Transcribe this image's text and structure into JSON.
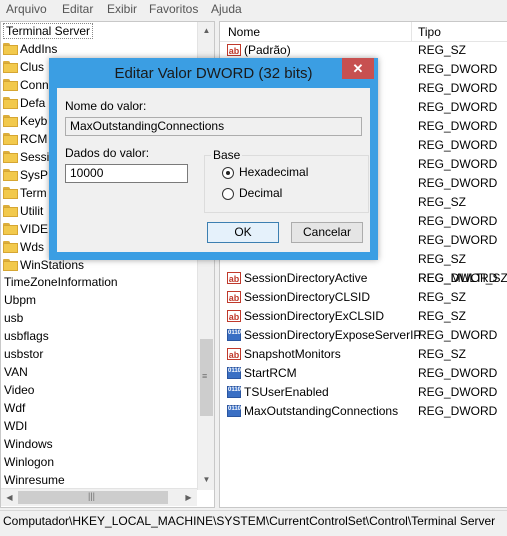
{
  "menubar": {
    "items": [
      "Arquivo",
      "Editar",
      "Exibir",
      "Favoritos",
      "Ajuda"
    ]
  },
  "tree": {
    "selected": "Terminal Server",
    "folders": [
      "AddIns",
      "Clus",
      "Conn",
      "Defa",
      "Keyb",
      "RCM",
      "Sessi",
      "SysP",
      "Term",
      "Utilit",
      "VIDE",
      "Wds",
      "WinStations"
    ],
    "keys": [
      "TimeZoneInformation",
      "Ubpm",
      "usb",
      "usbflags",
      "usbstor",
      "VAN",
      "Video",
      "Wdf",
      "WDI",
      "Windows",
      "Winlogon",
      "Winresume"
    ]
  },
  "list": {
    "col_name": "Nome",
    "col_type": "Tipo",
    "types_top": [
      "REG_SZ",
      "REG_DWORD",
      "REG_DWORD",
      "REG_DWORD",
      "REG_DWORD",
      "REG_DWORD",
      "REG_DWORD",
      "REG_DWORD",
      "REG_SZ",
      "REG_DWORD",
      "REG_DWORD",
      "REG_SZ",
      "REG_MULTI_SZ"
    ],
    "first_name": "(Padrão)",
    "rows": [
      {
        "icon": "ab",
        "name": "SessionDirectoryActive",
        "type": "REG_DWORD"
      },
      {
        "icon": "ab",
        "name": "SessionDirectoryCLSID",
        "type": "REG_SZ"
      },
      {
        "icon": "ab",
        "name": "SessionDirectoryExCLSID",
        "type": "REG_SZ"
      },
      {
        "icon": "bin",
        "name": "SessionDirectoryExposeServerIP",
        "type": "REG_DWORD"
      },
      {
        "icon": "ab",
        "name": "SnapshotMonitors",
        "type": "REG_SZ"
      },
      {
        "icon": "bin",
        "name": "StartRCM",
        "type": "REG_DWORD"
      },
      {
        "icon": "bin",
        "name": "TSUserEnabled",
        "type": "REG_DWORD"
      },
      {
        "icon": "bin",
        "name": "MaxOutstandingConnections",
        "type": "REG_DWORD"
      }
    ]
  },
  "statusbar": {
    "path": "Computador\\HKEY_LOCAL_MACHINE\\SYSTEM\\CurrentControlSet\\Control\\Terminal Server"
  },
  "dialog": {
    "title": "Editar Valor DWORD (32 bits)",
    "close": "✕",
    "value_name_label": "Nome do valor:",
    "value_name": "MaxOutstandingConnections",
    "value_data_label": "Dados do valor:",
    "value_data": "10000",
    "base_label": "Base",
    "radio_hex": "Hexadecimal",
    "radio_dec": "Decimal",
    "selected_base": "Hexadecimal",
    "ok": "OK",
    "cancel": "Cancelar"
  }
}
